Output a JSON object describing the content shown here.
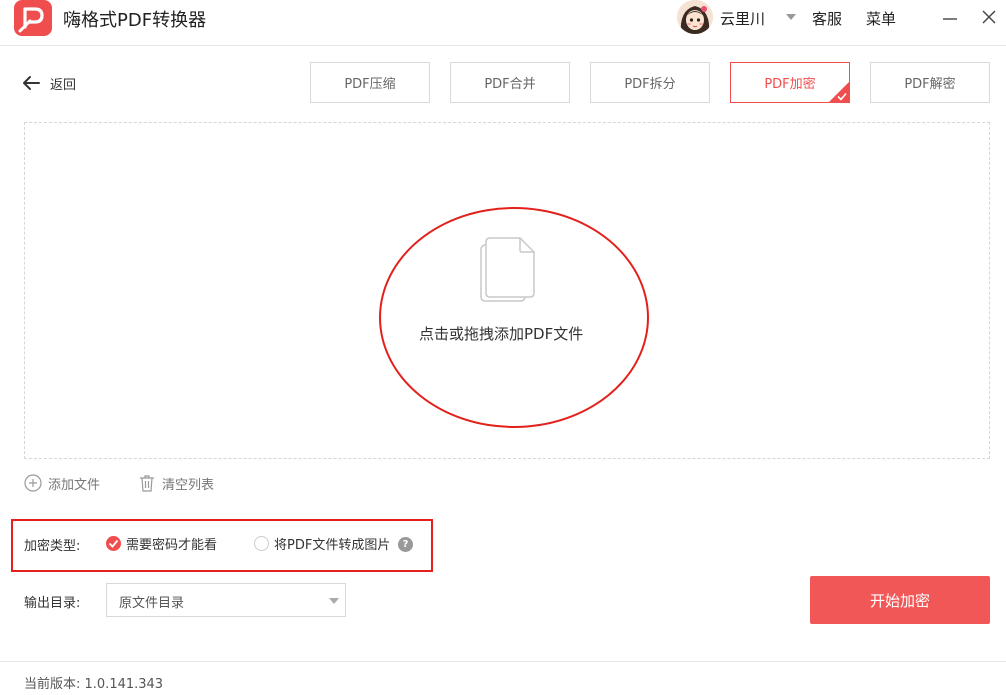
{
  "app": {
    "title": "嗨格式PDF转换器",
    "accent_color": "#f04e4e",
    "logo_icon": "pdf-p-logo"
  },
  "header": {
    "user_name": "云里川",
    "service_label": "客服",
    "menu_label": "菜单"
  },
  "nav": {
    "back_label": "返回",
    "tabs": [
      {
        "label": "PDF压缩",
        "active": false
      },
      {
        "label": "PDF合并",
        "active": false
      },
      {
        "label": "PDF拆分",
        "active": false
      },
      {
        "label": "PDF加密",
        "active": true
      },
      {
        "label": "PDF解密",
        "active": false
      }
    ]
  },
  "dropzone": {
    "prompt": "点击或拖拽添加PDF文件",
    "icon": "file-stack-icon"
  },
  "list_actions": {
    "add_label": "添加文件",
    "clear_label": "清空列表"
  },
  "encryption": {
    "type_label": "加密类型:",
    "options": [
      {
        "label": "需要密码才能看",
        "selected": true
      },
      {
        "label": "将PDF文件转成图片",
        "selected": false
      }
    ],
    "help_glyph": "?"
  },
  "output": {
    "label": "输出目录:",
    "selected": "原文件目录"
  },
  "start_button": "开始加密",
  "footer": {
    "version": "当前版本: 1.0.141.343"
  }
}
